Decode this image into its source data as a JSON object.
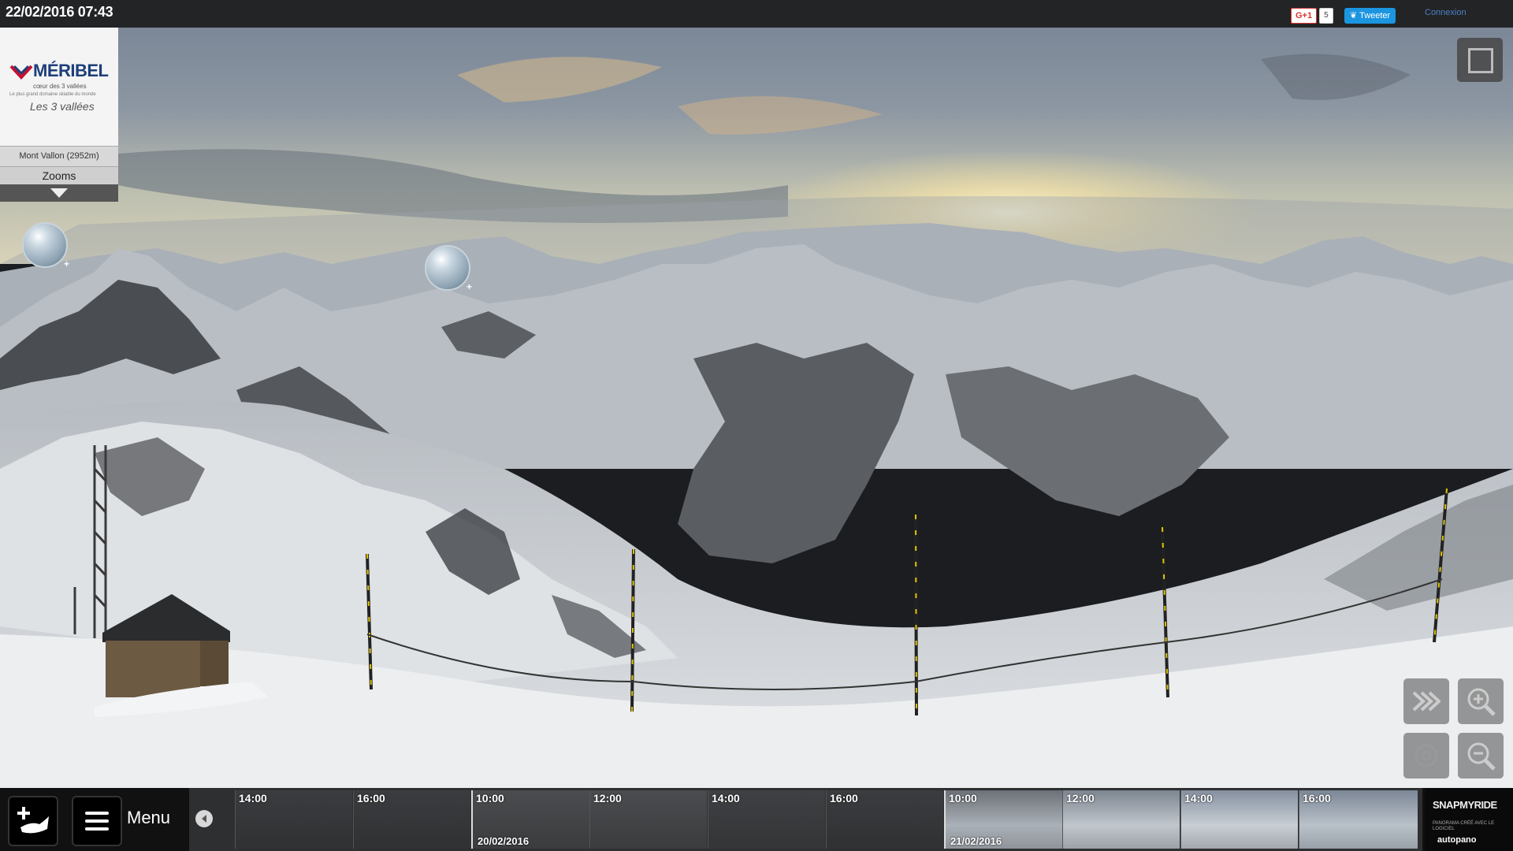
{
  "topbar": {
    "datetime": "22/02/2016 07:43",
    "gplus_label": "G+1",
    "gplus_count": "5",
    "tweet_label": "Tweeter",
    "login_label": "Connexion"
  },
  "logo": {
    "brand": "MÉRIBEL",
    "subtitle": "cœur des 3 vallées",
    "tagline": "Le plus grand domaine skiable du monde",
    "les3vallees": "Les 3 vallées"
  },
  "station": "Mont Vallon (2952m)",
  "zooms_label": "Zooms",
  "menu_label": "Menu",
  "timeline": {
    "thumbs": [
      {
        "time": "14:00",
        "date": ""
      },
      {
        "time": "16:00",
        "date": ""
      },
      {
        "time": "10:00",
        "date": "20/02/2016"
      },
      {
        "time": "12:00",
        "date": ""
      },
      {
        "time": "14:00",
        "date": ""
      },
      {
        "time": "16:00",
        "date": ""
      },
      {
        "time": "10:00",
        "date": "21/02/2016"
      },
      {
        "time": "12:00",
        "date": ""
      },
      {
        "time": "14:00",
        "date": ""
      },
      {
        "time": "16:00",
        "date": ""
      }
    ]
  },
  "corner_brand": {
    "name": "SNAPMYRIDE",
    "caption": "PANORAMA CRÉÉ AVEC LE LOGICIEL",
    "software": "autopano"
  },
  "icons": [
    "g-plus-icon",
    "twitter-icon",
    "fullscreen-icon",
    "fast-forward-icon",
    "zoom-in-icon",
    "rotate-icon",
    "zoom-out-icon",
    "add-panorama-icon",
    "menu-icon",
    "timeline-prev-icon",
    "zoom-bubble-icon",
    "chevron-down-icon"
  ],
  "colors": {
    "topbar": "#222426",
    "bottombar": "#111111",
    "tweet": "#1b95e0",
    "login_link": "#4f7fc9",
    "brand_blue": "#1d3f7a"
  }
}
